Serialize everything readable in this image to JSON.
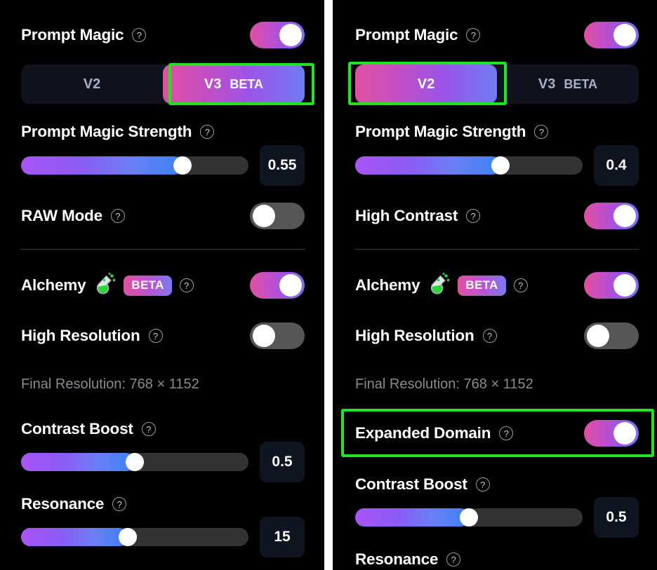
{
  "ui": {
    "help_glyph": "?",
    "highlight_color": "#22e322",
    "accent_gradient_start": "#e0519f",
    "accent_gradient_end": "#7b72ef",
    "slider_gradient_start": "#a855f7",
    "slider_gradient_end": "#3b82f6",
    "toggle_off_color": "#565658",
    "value_box_color": "#0e1420",
    "panel_background": "#000000"
  },
  "left_panel": {
    "prompt_magic": {
      "label": "Prompt Magic",
      "toggle_state": "on"
    },
    "version_selector": {
      "options": [
        {
          "label": "V2",
          "badge": "",
          "active": false
        },
        {
          "label": "V3",
          "badge": "BETA",
          "active": true
        }
      ],
      "highlighted_option": "V3"
    },
    "prompt_magic_strength": {
      "label": "Prompt Magic Strength",
      "value": "0.55",
      "fill_percent": 71
    },
    "raw_mode": {
      "label": "RAW Mode",
      "toggle_state": "off"
    },
    "alchemy": {
      "label": "Alchemy",
      "badge": "BETA",
      "icon": "flask-icon",
      "toggle_state": "on"
    },
    "high_resolution": {
      "label": "High Resolution",
      "toggle_state": "off"
    },
    "final_resolution": {
      "text": "Final Resolution: 768 × 1152"
    },
    "contrast_boost": {
      "label": "Contrast Boost",
      "value": "0.5",
      "fill_percent": 50
    },
    "resonance": {
      "label": "Resonance",
      "value": "15",
      "fill_percent": 47
    }
  },
  "right_panel": {
    "prompt_magic": {
      "label": "Prompt Magic",
      "toggle_state": "on"
    },
    "version_selector": {
      "options": [
        {
          "label": "V2",
          "badge": "",
          "active": true
        },
        {
          "label": "V3",
          "badge": "BETA",
          "active": false
        }
      ],
      "highlighted_option": "V2"
    },
    "prompt_magic_strength": {
      "label": "Prompt Magic Strength",
      "value": "0.4",
      "fill_percent": 64
    },
    "high_contrast": {
      "label": "High Contrast",
      "toggle_state": "on"
    },
    "alchemy": {
      "label": "Alchemy",
      "badge": "BETA",
      "icon": "flask-icon",
      "toggle_state": "on"
    },
    "high_resolution": {
      "label": "High Resolution",
      "toggle_state": "off"
    },
    "final_resolution": {
      "text": "Final Resolution: 768 × 1152"
    },
    "expanded_domain": {
      "label": "Expanded Domain",
      "toggle_state": "on",
      "highlighted": true
    },
    "contrast_boost": {
      "label": "Contrast Boost",
      "value": "0.5",
      "fill_percent": 50
    },
    "resonance": {
      "label": "Resonance"
    }
  }
}
